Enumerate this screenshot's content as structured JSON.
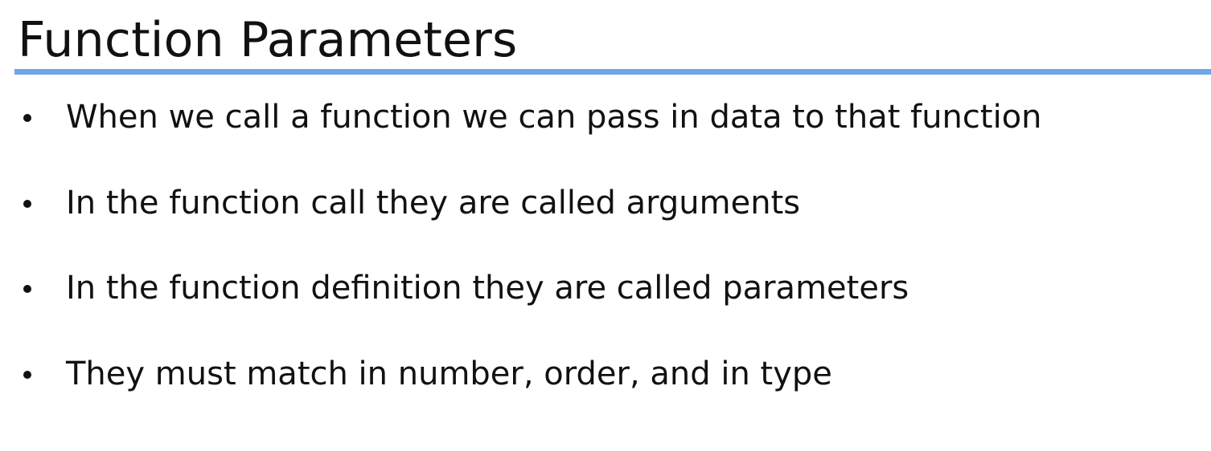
{
  "slide": {
    "title": "Function Parameters",
    "accent_color": "#6fa6e8",
    "bullets": [
      "When we call a function we can pass in data to that function",
      "In the function call they are called arguments",
      "In the function definition they are called parameters",
      "They must match in number, order, and in type"
    ]
  }
}
